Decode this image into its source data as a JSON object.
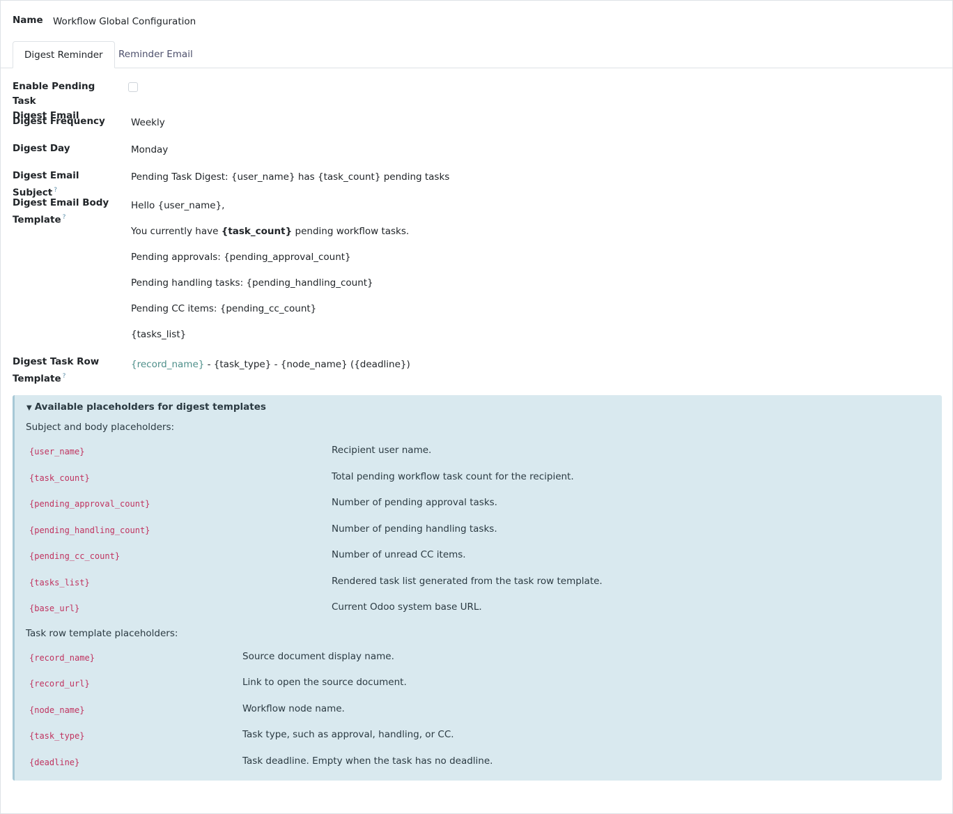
{
  "name_field": {
    "label": "Name",
    "value": "Workflow Global Configuration"
  },
  "tabs": [
    {
      "label": "Digest Reminder",
      "active": true
    },
    {
      "label": "Reminder Email",
      "active": false
    }
  ],
  "fields": {
    "enable": {
      "label_line1": "Enable Pending Task",
      "label_line2": "Digest Email",
      "checked": false
    },
    "frequency": {
      "label": "Digest Frequency",
      "value": "Weekly"
    },
    "day": {
      "label": "Digest Day",
      "value": "Monday"
    },
    "subject": {
      "label": "Digest Email Subject",
      "help": "?",
      "value": "Pending Task Digest: {user_name} has {task_count} pending tasks"
    },
    "body": {
      "label_line1": "Digest Email Body",
      "label_line2": "Template",
      "help": "?",
      "lines": [
        "Hello {user_name},",
        "You currently have ",
        "{task_count}",
        " pending workflow tasks.",
        "Pending approvals: {pending_approval_count}",
        "Pending handling tasks: {pending_handling_count}",
        "Pending CC items: {pending_cc_count}",
        "{tasks_list}"
      ]
    },
    "row_template": {
      "label_line1": "Digest Task Row",
      "label_line2": "Template",
      "help": "?",
      "link_part": "{record_name}",
      "rest": " - {task_type} - {node_name} ({deadline})"
    }
  },
  "panel": {
    "title": "Available placeholders for digest templates",
    "subject_section": "Subject and body placeholders:",
    "subject_placeholders": [
      {
        "code": "{user_name}",
        "desc": "Recipient user name."
      },
      {
        "code": "{task_count}",
        "desc": "Total pending workflow task count for the recipient."
      },
      {
        "code": "{pending_approval_count}",
        "desc": "Number of pending approval tasks."
      },
      {
        "code": "{pending_handling_count}",
        "desc": "Number of pending handling tasks."
      },
      {
        "code": "{pending_cc_count}",
        "desc": "Number of unread CC items."
      },
      {
        "code": "{tasks_list}",
        "desc": "Rendered task list generated from the task row template."
      },
      {
        "code": "{base_url}",
        "desc": "Current Odoo system base URL."
      }
    ],
    "row_section": "Task row template placeholders:",
    "row_placeholders": [
      {
        "code": "{record_name}",
        "desc": "Source document display name."
      },
      {
        "code": "{record_url}",
        "desc": "Link to open the source document."
      },
      {
        "code": "{node_name}",
        "desc": "Workflow node name."
      },
      {
        "code": "{task_type}",
        "desc": "Task type, such as approval, handling, or CC."
      },
      {
        "code": "{deadline}",
        "desc": "Task deadline. Empty when the task has no deadline."
      }
    ]
  }
}
